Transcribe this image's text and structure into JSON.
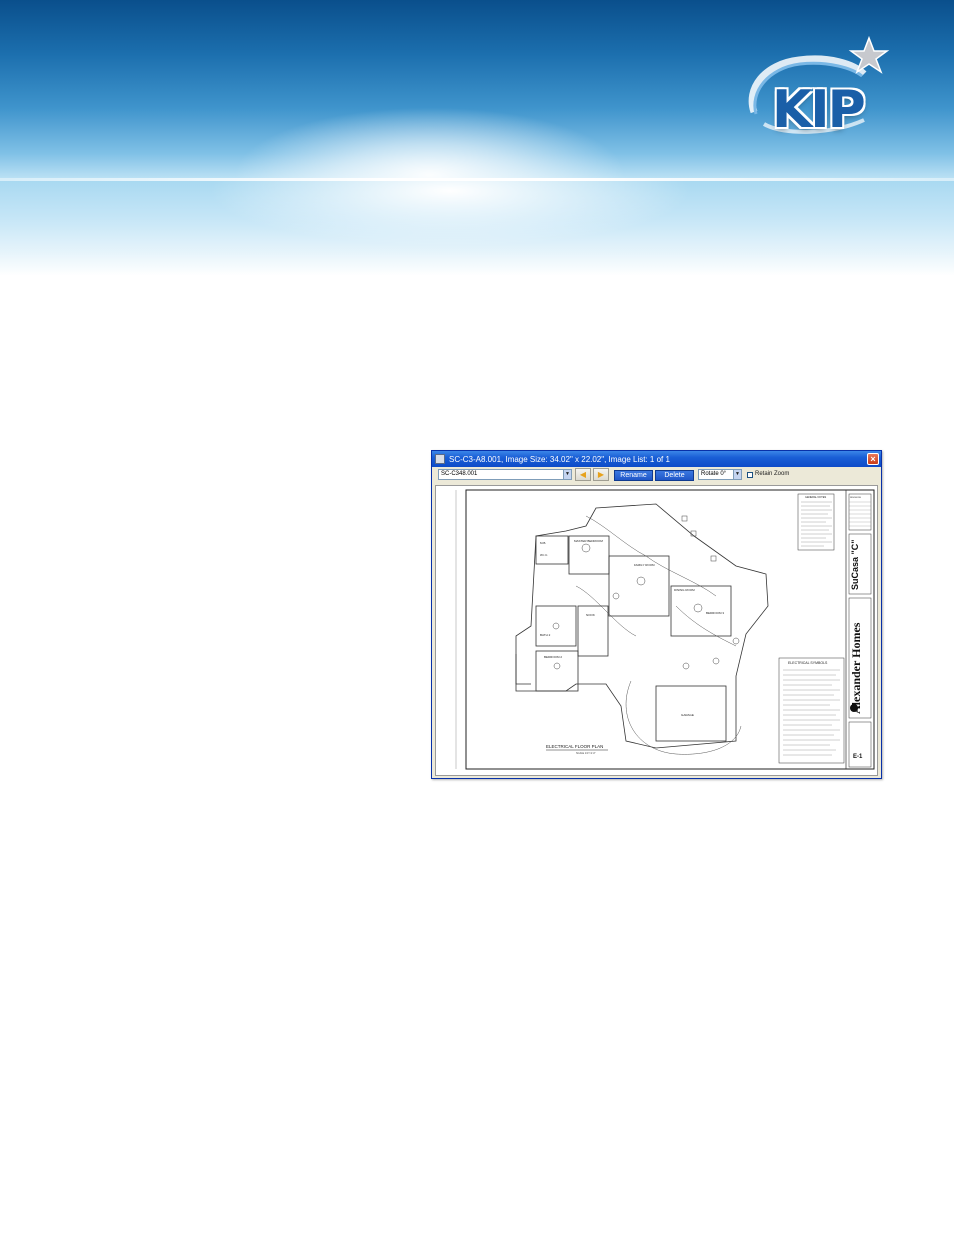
{
  "brand": {
    "logo_text": "KIP",
    "colors": {
      "banner_dark": "#0a4f8c",
      "banner_light": "#bfe3f5",
      "logo_blue": "#1a5fa8",
      "titlebar": "#1a5fd6",
      "button_blue": "#1f57c8"
    }
  },
  "window": {
    "title": "SC-C3-A8.001, Image Size: 34.02\" x 22.02\", Image List: 1 of 1",
    "close_icon": "close-icon"
  },
  "toolbar": {
    "file_value": "SC-C348.001",
    "prev_icon": "arrow-left-icon",
    "next_icon": "arrow-right-icon",
    "rename_label": "Rename",
    "delete_label": "Delete",
    "rotate_value": "Rotate 0°",
    "rotate_options": [
      "Rotate 0°"
    ],
    "retain_zoom_label": "Retain Zoom",
    "retain_zoom_checked": false
  },
  "drawing": {
    "plan_title": "ELECTRICAL FLOOR PLAN",
    "scale": "SCALE 1/4\"=1'-0\"",
    "rooms": [
      "MASTER BEDROOM",
      "FAMILY ROOM",
      "DINING ROOM",
      "BEDROOM 3",
      "BEDROOM 2",
      "BATH 2",
      "NOOK",
      "GARAGE",
      "M.B.",
      "W.I.C."
    ],
    "notes_title": "GENERAL NOTES",
    "symbols_title": "ELECTRICAL SYMBOLS",
    "company": "Alexander Homes",
    "project": "SuCasa \"C\"",
    "sheet": "E-1",
    "revisions_title": "REVISIONS"
  }
}
